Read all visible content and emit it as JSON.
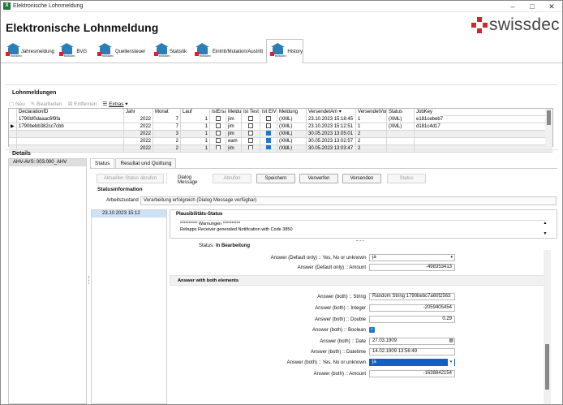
{
  "window": {
    "title": "Elektronische Lohnmeldung",
    "app_icon_text": "X"
  },
  "header": {
    "title": "Elektronische Lohnmeldung",
    "logo_text": "swissdec"
  },
  "main_tabs": [
    {
      "label": "Jahresmeldung",
      "icon_caption": "swissdec"
    },
    {
      "label": "BVG",
      "icon_caption": "swissdec"
    },
    {
      "label": "Quellensteuer",
      "icon_caption": "swissdec"
    },
    {
      "label": "Statistik",
      "icon_caption": "swissdec"
    },
    {
      "label": "Eintritt/Mutation/Austritt",
      "icon_caption": "swissdec"
    },
    {
      "label": "History",
      "icon_caption": "swissdec"
    }
  ],
  "lohnmeldungen": {
    "title": "Lohnmeldungen",
    "toolbar": {
      "new": "Neu",
      "edit": "Bearbeiten",
      "delete": "Entfernen",
      "extras": "Extras"
    },
    "columns": [
      "DeclarationID",
      "Jahr",
      "Monat",
      "Lauf",
      "IstErsatz",
      "Meldung",
      "Ist Test",
      "Ist EIV",
      "Meldung",
      "VersendetAm",
      "VersendetVon",
      "Status",
      "JobKey"
    ],
    "rows": [
      {
        "declaration_id": "1790bf0daaac6f9fa",
        "jahr": "2022",
        "monat": "7",
        "lauf": "1",
        "ersatz": false,
        "by": "jim",
        "test": false,
        "eiv": false,
        "meldung": "(XML)",
        "sent_at": "23.10.2023 15:18:45",
        "sent_by": "1",
        "status": "(XML)",
        "jobkey": "e181cebeb7",
        "current": false,
        "alt": false
      },
      {
        "declaration_id": "1790bebb382cc7cbb",
        "jahr": "2022",
        "monat": "7",
        "lauf": "1",
        "ersatz": false,
        "by": "jim",
        "test": false,
        "eiv": false,
        "meldung": "(XML)",
        "sent_at": "23.10.2023 15:12:51",
        "sent_by": "1",
        "status": "(XML)",
        "jobkey": "d181c4d17",
        "current": true,
        "alt": false
      },
      {
        "declaration_id": "",
        "jahr": "2022",
        "monat": "3",
        "lauf": "1",
        "ersatz": false,
        "by": "jim",
        "test": false,
        "eiv": true,
        "meldung": "(XML)",
        "sent_at": "30.05.2023 13:05:01",
        "sent_by": "2",
        "status": "",
        "jobkey": "",
        "current": false,
        "alt": true
      },
      {
        "declaration_id": "",
        "jahr": "2022",
        "monat": "2",
        "lauf": "1",
        "ersatz": false,
        "by": "eam",
        "test": false,
        "eiv": true,
        "meldung": "(XML)",
        "sent_at": "30.05.2023 13:02:57",
        "sent_by": "2",
        "status": "",
        "jobkey": "",
        "current": false,
        "alt": false
      },
      {
        "declaration_id": "",
        "jahr": "2022",
        "monat": "2",
        "lauf": "1",
        "ersatz": false,
        "by": "jim",
        "test": false,
        "eiv": true,
        "meldung": "(XML)",
        "sent_at": "30.05.2023 13:03:47",
        "sent_by": "2",
        "status": "",
        "jobkey": "",
        "current": false,
        "alt": true
      }
    ]
  },
  "details": {
    "title": "Details",
    "left_item": "AHV-AVS: 003.000_AHV",
    "tabs": [
      "Status",
      "Resultat und Quittung"
    ],
    "buttons": {
      "get_status": "Aktuellen Status abrufen",
      "dialog_message": "Dialog Message",
      "fetch": "Abrufen",
      "save": "Speichern",
      "discard": "Verwerfen",
      "send": "Versenden",
      "status": "Status"
    },
    "status_info": {
      "title": "Statusinformation",
      "label": "Arbeitszustand",
      "value": "Verarbeitung erfolgreich (Dialog Message verfügbar)"
    },
    "date_item": "23.10.2023 15:12",
    "plausi": {
      "title": "Plausibilitäts-Status",
      "line1": "********** Warnungen **********",
      "line2": "Refapps Receiver generated Notification with Code 3850"
    },
    "status_label": "Status:",
    "status_value": "In Bearbeitung",
    "fields_top": [
      {
        "label": "Answer (Default only) :: Yes, No or unknown",
        "value": "ja"
      },
      {
        "label": "Answer (Default only) :: Amount",
        "value": "-498353413"
      }
    ],
    "group_title": "Answer with both elements",
    "fields_both": [
      {
        "label": "Answer (both) :: String",
        "value": "Random String 1790bebc7a60f2563"
      },
      {
        "label": "Answer (both) :: Integer",
        "value": "-2059405454"
      },
      {
        "label": "Answer (both) :: Double",
        "value": "0.29"
      },
      {
        "label": "Answer (both) :: Boolean",
        "value": ""
      },
      {
        "label": "Answer (both) :: Date",
        "value": "27.03.1909"
      },
      {
        "label": "Answer (both) :: Datetime",
        "value": "14.02.1909 13:56:49"
      },
      {
        "label": "Answer (both) :: Yes, No or unknown",
        "value": "ja"
      },
      {
        "label": "Answer (both) :: Amount",
        "value": "-1638842154"
      }
    ]
  },
  "colors": {
    "accent": "#1e77d1",
    "selection": "#1060c8",
    "brand_red": "#d8232a"
  }
}
